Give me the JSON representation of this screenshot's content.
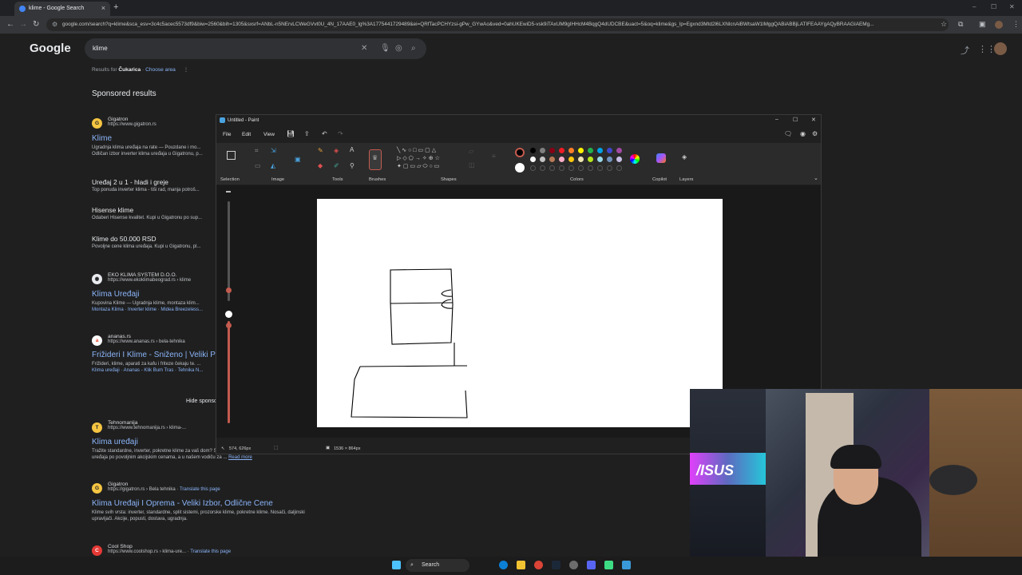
{
  "browser": {
    "tab_title": "klime - Google Search",
    "url": "google.com/search?q=klime&sca_esv=3c4c5acec5573df9&biw=2560&bih=1305&sxsrf=ANbL-n5NErvLCWeGVvt0U_4N_17AAE0_lg%3A1775441729489&ei=QRfTacPCHYzsi-gPw_GYwAo&ved=0ahUKEwiD5-vsk9iTAxUM9gIHHcM4BqgQ4dUDCBE&uact=5&oq=klime&gs_lp=Egxnd3Mtd2l6LXNlcnAiBWtsaW1lMggQABiABBjLATIFEAAYgAQyBRAAGIAEMg..."
  },
  "google": {
    "logo": "Google",
    "query": "klime",
    "results_for_label": "Results for",
    "location": "Čukarica",
    "choose_area": "Choose area",
    "sponsored_heading": "Sponsored results",
    "hide_sponsored": "Hide sponsored results",
    "ads": [
      {
        "site": "Gigatron",
        "url": "https://www.gigatron.rs",
        "title": "Klime",
        "desc1": "Ugradnja klima uređaja na rate — Pouzdane i mo...",
        "desc2": "Odličan izbor inverter klima uređaja u Gigatronu, p..."
      },
      {
        "site": "EKO KLIMA SYSTEM D.O.O.",
        "url": "https://www.ekoklimabeograd.rs › klime",
        "title": "Klima Uređaji",
        "desc1": "Kupovina Klime — Ugradnja klime, montaza klim...",
        "sub": "Montaza Klima · Inverter klime · Midea Breezeless..."
      },
      {
        "site": "ananas.rs",
        "url": "https://www.ananas.rs › bela-tehnika",
        "title": "Frižideri I Klime - Sniženo | Veliki Po...",
        "desc1": "Frižideri, klime, aparati za kafu i friteze čekaju te. ...",
        "sub": "Klima uređaji · Ananas - Klik Bum Tras · Tehnika N..."
      }
    ],
    "sitelinks": [
      {
        "title": "Uređaj 2 u 1 - hladi i greje",
        "desc": "Top ponuda inverter klima - tiši rad, manja potroš..."
      },
      {
        "title": "Hisense klime",
        "desc": "Odaberi Hisense kvalitet. Kupi u Gigatronu po sup..."
      },
      {
        "title": "Klime do 50.000 RSD",
        "desc": "Povoljne cene klima uređaja. Kupi u Gigatronu, pl..."
      }
    ],
    "organic": [
      {
        "site": "Tehnomanija",
        "url": "https://www.tehnomanija.rs › klima-...",
        "title": "Klima uređaji",
        "desc1": "Tražite standardne, inverter, pokretne klime za vaš dom? Saznajte više...",
        "desc2": "uređaja po povoljnim akcijskim cenama, a u našem vodiču za ...",
        "readmore": "Read more"
      },
      {
        "site": "Gigatron",
        "url": "https://gigatron.rs › Bela tehnika",
        "translate": "Translate this page",
        "title": "Klima Uređaji I Oprema - Veliki Izbor, Odlične Cene",
        "desc1": "Klime svih vrsta: inverter, standardne, split sistemi, prozorske klime, pokretne klime. Nosači, daljinski",
        "desc2": "upravljači. Akcije, popusti, dostava, ugradnja."
      },
      {
        "site": "Cool Shop",
        "url": "https://www.coolshop.rs › klima-ure...",
        "translate": "Translate this page"
      }
    ]
  },
  "paint": {
    "title": "Untitled - Paint",
    "menu": {
      "file": "File",
      "edit": "Edit",
      "view": "View"
    },
    "groups": {
      "selection": "Selection",
      "image": "Image",
      "tools": "Tools",
      "brushes": "Brushes",
      "shapes": "Shapes",
      "colors": "Colors",
      "copilot": "Copilot",
      "layers": "Layers"
    },
    "status": {
      "cursor": "574, 626px",
      "canvas_size": "1536 × 864px"
    },
    "palette_row1": [
      "#000000",
      "#7f7f7f",
      "#880015",
      "#ed1c24",
      "#ff7f27",
      "#fff200",
      "#22b14c",
      "#00a2e8",
      "#3f48cc",
      "#a349a4"
    ],
    "palette_row2": [
      "#ffffff",
      "#c3c3c3",
      "#b97a57",
      "#ffaec9",
      "#ffc90e",
      "#efe4b0",
      "#b5e61d",
      "#99d9ea",
      "#7092be",
      "#c8bfe7"
    ]
  },
  "taskbar": {
    "search": "Search"
  }
}
